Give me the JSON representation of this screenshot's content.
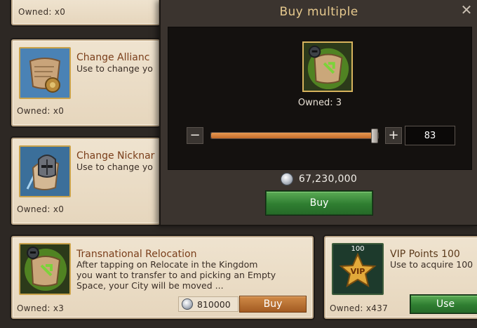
{
  "cards": {
    "top": {
      "owned": "Owned: x0"
    },
    "alliance": {
      "title": "Change Allianc",
      "desc": "Use to change yo",
      "owned": "Owned: x0"
    },
    "nickname": {
      "title": "Change Nicknar",
      "desc": "Use to change yo",
      "owned": "Owned: x0"
    },
    "relocation": {
      "title": "Transnational Relocation",
      "desc_line1": "After tapping on Relocate in the Kingdom",
      "desc_line2": "you want to transfer to and picking an Empty",
      "desc_line3": "Space, your City will be moved ...",
      "owned": "Owned: x3",
      "price": "810000",
      "buy_label": "Buy"
    },
    "vip": {
      "badge": "100",
      "icon_text": "VIP",
      "title": "VIP Points 100",
      "desc": "Use to acquire 100",
      "owned": "Owned: x437",
      "use_label": "Use"
    }
  },
  "modal": {
    "title": "Buy multiple",
    "close_glyph": "✕",
    "owned": "Owned: 3",
    "minus_glyph": "−",
    "plus_glyph": "+",
    "quantity": "83",
    "slider_fraction": 0.98,
    "price": "67,230,000",
    "buy_label": "Buy"
  }
}
